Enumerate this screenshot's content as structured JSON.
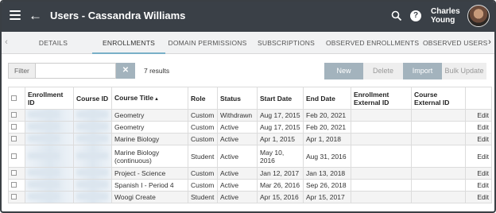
{
  "header": {
    "title": "Users - Cassandra Williams",
    "user_name": "Charles Young",
    "help_label": "?"
  },
  "tabs": [
    {
      "label": "DETAILS"
    },
    {
      "label": "ENROLLMENTS"
    },
    {
      "label": "DOMAIN PERMISSIONS"
    },
    {
      "label": "SUBSCRIPTIONS"
    },
    {
      "label": "OBSERVED ENROLLMENTS"
    },
    {
      "label": "OBSERVED USERS"
    }
  ],
  "filter": {
    "label": "Filter",
    "value": "",
    "clear_label": "✕",
    "results": "7 results"
  },
  "actions": {
    "new": "New",
    "delete": "Delete",
    "import": "Import",
    "bulk_update": "Bulk Update"
  },
  "table": {
    "headers": [
      "Enrollment ID",
      "Course ID",
      "Course Title",
      "Role",
      "Status",
      "Start Date",
      "End Date",
      "Enrollment External ID",
      "Course External ID"
    ],
    "sort_indicator": "▲",
    "edit_label": "Edit",
    "rows": [
      {
        "title": "Geometry",
        "role": "Custom",
        "status": "Withdrawn",
        "start": "Aug 17, 2015",
        "end": "Feb 20, 2021"
      },
      {
        "title": "Geometry",
        "role": "Custom",
        "status": "Active",
        "start": "Aug 17, 2015",
        "end": "Feb 20, 2021"
      },
      {
        "title": "Marine Biology",
        "role": "Custom",
        "status": "Active",
        "start": "Apr 1, 2015",
        "end": "Apr 1, 2018"
      },
      {
        "title": "Marine Biology (continuous)",
        "role": "Student",
        "status": "Active",
        "start": "May 10, 2016",
        "end": "Aug 31, 2016"
      },
      {
        "title": "Project - Science",
        "role": "Custom",
        "status": "Active",
        "start": "Jan 12, 2017",
        "end": "Jan 13, 2018"
      },
      {
        "title": "Spanish I - Period 4",
        "role": "Custom",
        "status": "Active",
        "start": "Mar 26, 2016",
        "end": "Sep 26, 2018"
      },
      {
        "title": "Woogi Create",
        "role": "Student",
        "status": "Active",
        "start": "Apr 15, 2016",
        "end": "Apr 15, 2017"
      }
    ]
  }
}
